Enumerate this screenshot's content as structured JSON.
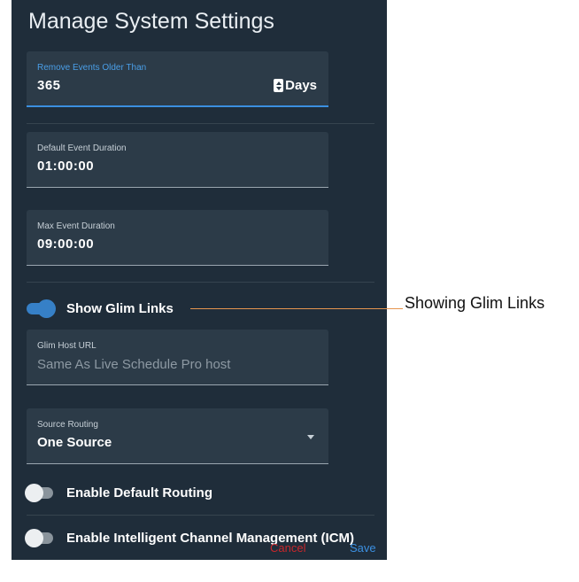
{
  "dialog": {
    "title": "Manage System Settings",
    "colors": {
      "background": "#1f2d3a",
      "field": "#2c3b48",
      "accent": "#3b8fe0",
      "danger": "#c8262b"
    }
  },
  "fields": {
    "remove_events": {
      "label": "Remove Events Older Than",
      "value": "365",
      "unit": "Days"
    },
    "default_duration": {
      "label": "Default Event Duration",
      "value": "01:00:00"
    },
    "max_duration": {
      "label": "Max Event Duration",
      "value": "09:00:00"
    },
    "glim_host": {
      "label": "Glim Host URL",
      "placeholder": "Same As Live Schedule Pro host"
    },
    "source_routing": {
      "label": "Source Routing",
      "value": "One Source"
    }
  },
  "toggles": {
    "show_glim_links": {
      "label": "Show Glim Links",
      "on": true
    },
    "default_routing": {
      "label": "Enable Default Routing",
      "on": false
    },
    "icm": {
      "label": "Enable Intelligent Channel Management (ICM)",
      "on": false
    }
  },
  "actions": {
    "cancel": "Cancel",
    "save": "Save"
  },
  "callout": {
    "text": "Showing Glim Links"
  }
}
